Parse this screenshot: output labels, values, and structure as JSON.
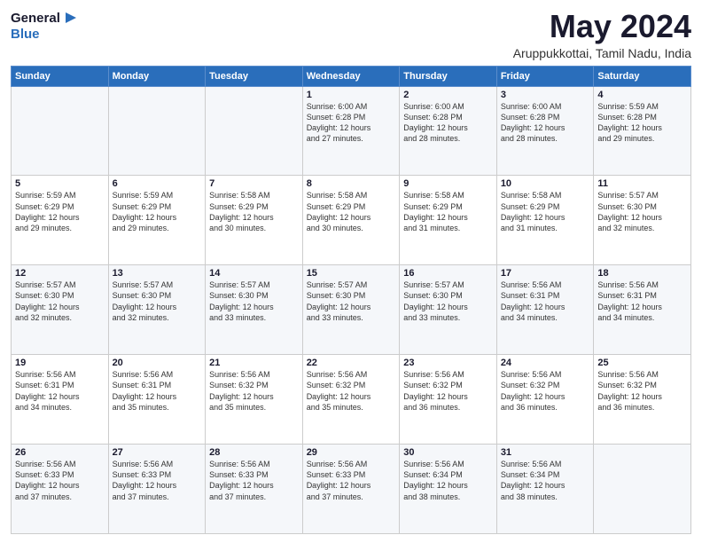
{
  "logo": {
    "line1": "General",
    "line2": "Blue",
    "arrow": "▶"
  },
  "title": "May 2024",
  "location": "Aruppukkottai, Tamil Nadu, India",
  "days_of_week": [
    "Sunday",
    "Monday",
    "Tuesday",
    "Wednesday",
    "Thursday",
    "Friday",
    "Saturday"
  ],
  "weeks": [
    [
      {
        "day": "",
        "info": ""
      },
      {
        "day": "",
        "info": ""
      },
      {
        "day": "",
        "info": ""
      },
      {
        "day": "1",
        "info": "Sunrise: 6:00 AM\nSunset: 6:28 PM\nDaylight: 12 hours\nand 27 minutes."
      },
      {
        "day": "2",
        "info": "Sunrise: 6:00 AM\nSunset: 6:28 PM\nDaylight: 12 hours\nand 28 minutes."
      },
      {
        "day": "3",
        "info": "Sunrise: 6:00 AM\nSunset: 6:28 PM\nDaylight: 12 hours\nand 28 minutes."
      },
      {
        "day": "4",
        "info": "Sunrise: 5:59 AM\nSunset: 6:28 PM\nDaylight: 12 hours\nand 29 minutes."
      }
    ],
    [
      {
        "day": "5",
        "info": "Sunrise: 5:59 AM\nSunset: 6:29 PM\nDaylight: 12 hours\nand 29 minutes."
      },
      {
        "day": "6",
        "info": "Sunrise: 5:59 AM\nSunset: 6:29 PM\nDaylight: 12 hours\nand 29 minutes."
      },
      {
        "day": "7",
        "info": "Sunrise: 5:58 AM\nSunset: 6:29 PM\nDaylight: 12 hours\nand 30 minutes."
      },
      {
        "day": "8",
        "info": "Sunrise: 5:58 AM\nSunset: 6:29 PM\nDaylight: 12 hours\nand 30 minutes."
      },
      {
        "day": "9",
        "info": "Sunrise: 5:58 AM\nSunset: 6:29 PM\nDaylight: 12 hours\nand 31 minutes."
      },
      {
        "day": "10",
        "info": "Sunrise: 5:58 AM\nSunset: 6:29 PM\nDaylight: 12 hours\nand 31 minutes."
      },
      {
        "day": "11",
        "info": "Sunrise: 5:57 AM\nSunset: 6:30 PM\nDaylight: 12 hours\nand 32 minutes."
      }
    ],
    [
      {
        "day": "12",
        "info": "Sunrise: 5:57 AM\nSunset: 6:30 PM\nDaylight: 12 hours\nand 32 minutes."
      },
      {
        "day": "13",
        "info": "Sunrise: 5:57 AM\nSunset: 6:30 PM\nDaylight: 12 hours\nand 32 minutes."
      },
      {
        "day": "14",
        "info": "Sunrise: 5:57 AM\nSunset: 6:30 PM\nDaylight: 12 hours\nand 33 minutes."
      },
      {
        "day": "15",
        "info": "Sunrise: 5:57 AM\nSunset: 6:30 PM\nDaylight: 12 hours\nand 33 minutes."
      },
      {
        "day": "16",
        "info": "Sunrise: 5:57 AM\nSunset: 6:30 PM\nDaylight: 12 hours\nand 33 minutes."
      },
      {
        "day": "17",
        "info": "Sunrise: 5:56 AM\nSunset: 6:31 PM\nDaylight: 12 hours\nand 34 minutes."
      },
      {
        "day": "18",
        "info": "Sunrise: 5:56 AM\nSunset: 6:31 PM\nDaylight: 12 hours\nand 34 minutes."
      }
    ],
    [
      {
        "day": "19",
        "info": "Sunrise: 5:56 AM\nSunset: 6:31 PM\nDaylight: 12 hours\nand 34 minutes."
      },
      {
        "day": "20",
        "info": "Sunrise: 5:56 AM\nSunset: 6:31 PM\nDaylight: 12 hours\nand 35 minutes."
      },
      {
        "day": "21",
        "info": "Sunrise: 5:56 AM\nSunset: 6:32 PM\nDaylight: 12 hours\nand 35 minutes."
      },
      {
        "day": "22",
        "info": "Sunrise: 5:56 AM\nSunset: 6:32 PM\nDaylight: 12 hours\nand 35 minutes."
      },
      {
        "day": "23",
        "info": "Sunrise: 5:56 AM\nSunset: 6:32 PM\nDaylight: 12 hours\nand 36 minutes."
      },
      {
        "day": "24",
        "info": "Sunrise: 5:56 AM\nSunset: 6:32 PM\nDaylight: 12 hours\nand 36 minutes."
      },
      {
        "day": "25",
        "info": "Sunrise: 5:56 AM\nSunset: 6:32 PM\nDaylight: 12 hours\nand 36 minutes."
      }
    ],
    [
      {
        "day": "26",
        "info": "Sunrise: 5:56 AM\nSunset: 6:33 PM\nDaylight: 12 hours\nand 37 minutes."
      },
      {
        "day": "27",
        "info": "Sunrise: 5:56 AM\nSunset: 6:33 PM\nDaylight: 12 hours\nand 37 minutes."
      },
      {
        "day": "28",
        "info": "Sunrise: 5:56 AM\nSunset: 6:33 PM\nDaylight: 12 hours\nand 37 minutes."
      },
      {
        "day": "29",
        "info": "Sunrise: 5:56 AM\nSunset: 6:33 PM\nDaylight: 12 hours\nand 37 minutes."
      },
      {
        "day": "30",
        "info": "Sunrise: 5:56 AM\nSunset: 6:34 PM\nDaylight: 12 hours\nand 38 minutes."
      },
      {
        "day": "31",
        "info": "Sunrise: 5:56 AM\nSunset: 6:34 PM\nDaylight: 12 hours\nand 38 minutes."
      },
      {
        "day": "",
        "info": ""
      }
    ]
  ]
}
